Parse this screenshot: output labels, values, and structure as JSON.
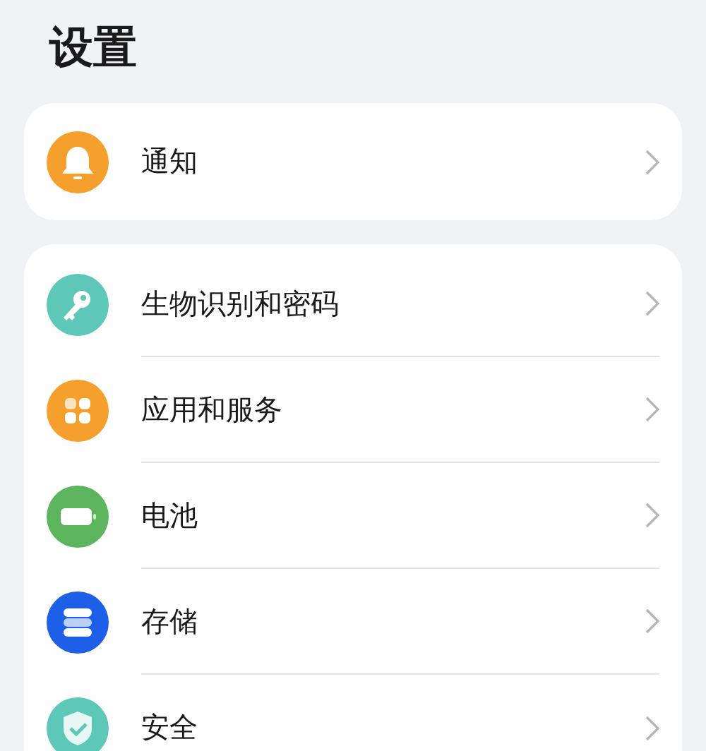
{
  "title": "设置",
  "groups": [
    {
      "items": [
        {
          "label": "通知",
          "kind": "bell",
          "color": "#f5a02c"
        }
      ]
    },
    {
      "items": [
        {
          "label": "生物识别和密码",
          "kind": "key",
          "color": "#5ec8b8"
        },
        {
          "label": "应用和服务",
          "kind": "apps",
          "color": "#f5a02c"
        },
        {
          "label": "电池",
          "kind": "battery",
          "color": "#5cb45c"
        },
        {
          "label": "存储",
          "kind": "storage",
          "color": "#1d5fe6"
        },
        {
          "label": "安全",
          "kind": "shield",
          "color": "#5ec8b8"
        }
      ]
    }
  ]
}
